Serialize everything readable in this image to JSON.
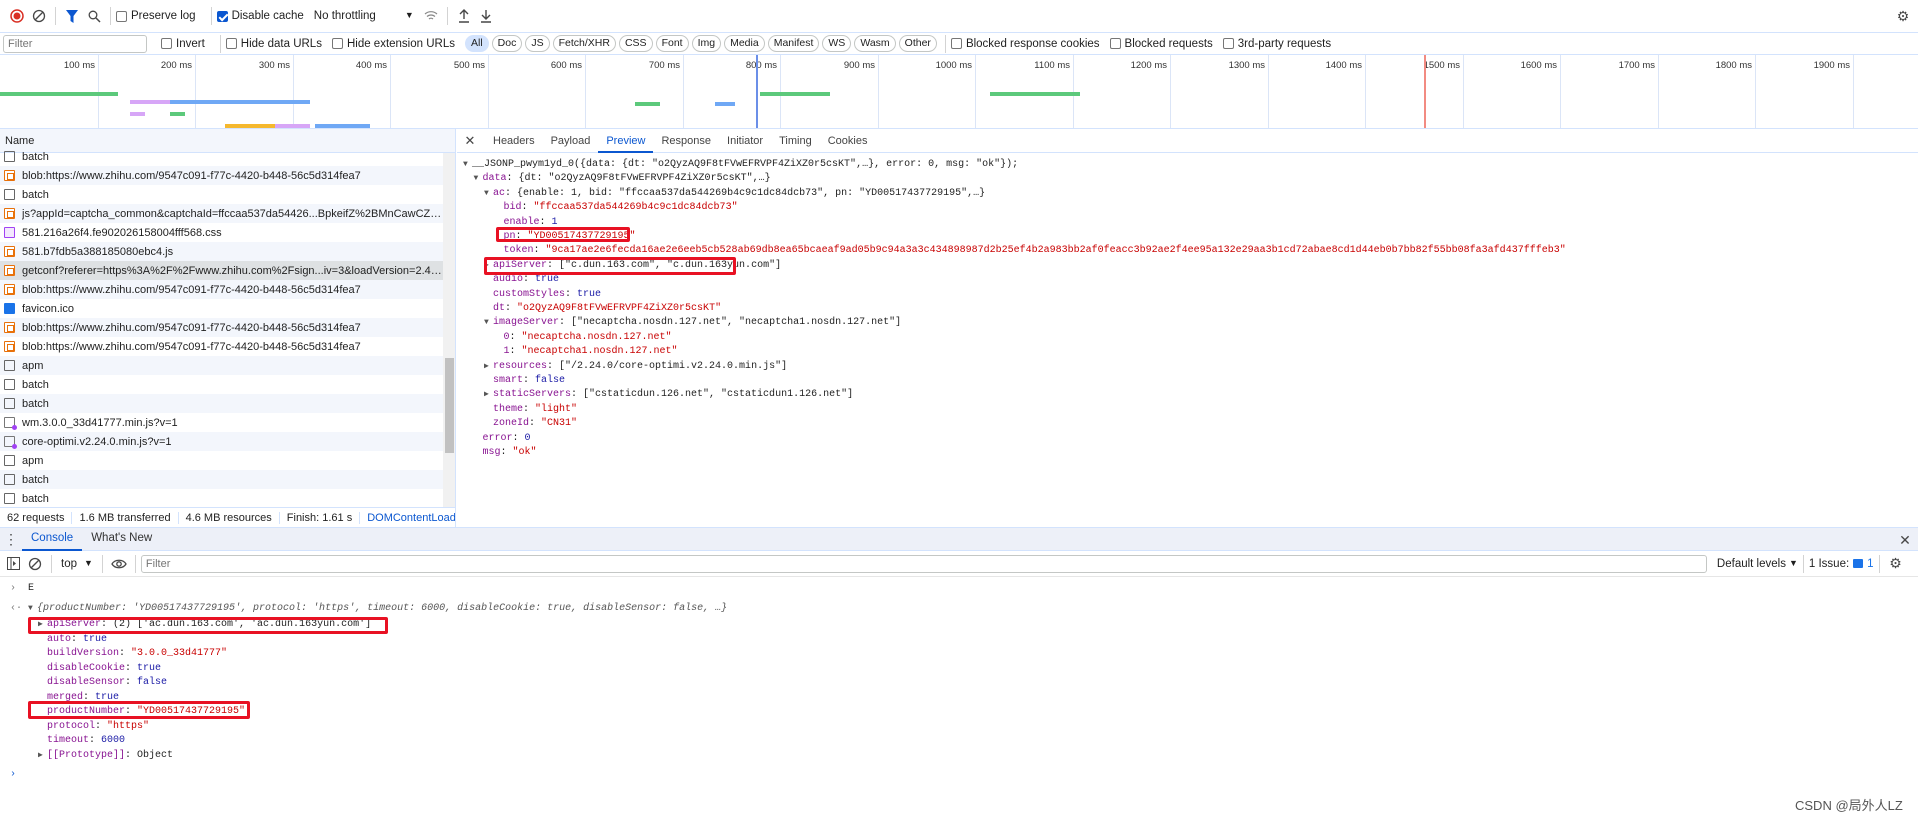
{
  "toolbar": {
    "preserve_log": "Preserve log",
    "preserve_log_checked": false,
    "disable_cache": "Disable cache",
    "disable_cache_checked": true,
    "throttling": "No throttling"
  },
  "filterbar": {
    "placeholder": "Filter",
    "invert": "Invert",
    "hide_data_urls": "Hide data URLs",
    "hide_extension_urls": "Hide extension URLs",
    "types": [
      "All",
      "Doc",
      "JS",
      "Fetch/XHR",
      "CSS",
      "Font",
      "Img",
      "Media",
      "Manifest",
      "WS",
      "Wasm",
      "Other"
    ],
    "selected_type": "All",
    "blocked_cookies": "Blocked response cookies",
    "blocked_requests": "Blocked requests",
    "third_party": "3rd-party requests"
  },
  "timeline": {
    "ticks": [
      "100 ms",
      "200 ms",
      "300 ms",
      "400 ms",
      "500 ms",
      "600 ms",
      "700 ms",
      "800 ms",
      "900 ms",
      "1000 ms",
      "1100 ms",
      "1200 ms",
      "1300 ms",
      "1400 ms",
      "1500 ms",
      "1600 ms",
      "1700 ms",
      "1800 ms",
      "1900 ms"
    ]
  },
  "requests": {
    "header": "Name",
    "items": [
      {
        "name": "batch",
        "type": "doc"
      },
      {
        "name": "blob:https://www.zhihu.com/9547c091-f77c-4420-b448-56c5d314fea7",
        "type": "script"
      },
      {
        "name": "batch",
        "type": "doc"
      },
      {
        "name": "js?appId=captcha_common&captchaId=ffccaa537da54426...BpkeifZ%2BMnCawCZOAZ...",
        "type": "script"
      },
      {
        "name": "581.216a26f4.fe902026158004fff568.css",
        "type": "css"
      },
      {
        "name": "581.b7fdb5a388185080ebc4.js",
        "type": "script"
      },
      {
        "name": "getconf?referer=https%3A%2F%2Fwww.zhihu.com%2Fsign...iv=3&loadVersion=2.4.0&...",
        "type": "script",
        "selected": true
      },
      {
        "name": "blob:https://www.zhihu.com/9547c091-f77c-4420-b448-56c5d314fea7",
        "type": "script"
      },
      {
        "name": "favicon.ico",
        "type": "img"
      },
      {
        "name": "blob:https://www.zhihu.com/9547c091-f77c-4420-b448-56c5d314fea7",
        "type": "script"
      },
      {
        "name": "blob:https://www.zhihu.com/9547c091-f77c-4420-b448-56c5d314fea7",
        "type": "script"
      },
      {
        "name": "apm",
        "type": "doc"
      },
      {
        "name": "batch",
        "type": "doc"
      },
      {
        "name": "batch",
        "type": "doc"
      },
      {
        "name": "wm.3.0.0_33d41777.min.js?v=1",
        "type": "wasm"
      },
      {
        "name": "core-optimi.v2.24.0.min.js?v=1",
        "type": "wasm"
      },
      {
        "name": "apm",
        "type": "doc"
      },
      {
        "name": "batch",
        "type": "doc"
      },
      {
        "name": "batch",
        "type": "doc"
      }
    ]
  },
  "summary": [
    "62 requests",
    "1.6 MB transferred",
    "4.6 MB resources",
    "Finish: 1.61 s",
    "DOMContentLoaded"
  ],
  "detail": {
    "tabs": [
      "Headers",
      "Payload",
      "Preview",
      "Response",
      "Initiator",
      "Timing",
      "Cookies"
    ],
    "selected_tab": "Preview",
    "preview": [
      {
        "i": 0,
        "a": "down",
        "k": "",
        "v": "__JSONP_pwym1yd_0({data: {dt: \"o2QyzAQ9F8tFVwEFRVPF4ZiXZ0r5csKT\",…}, error: 0, msg: \"ok\"});",
        "t": "p"
      },
      {
        "i": 1,
        "a": "down",
        "k": "data",
        "v": "{dt: \"o2QyzAQ9F8tFVwEFRVPF4ZiXZ0r5csKT\",…}",
        "t": "p"
      },
      {
        "i": 2,
        "a": "down",
        "k": "ac",
        "v": "{enable: 1, bid: \"ffccaa537da544269b4c9c1dc84dcb73\", pn: \"YD00517437729195\",…}",
        "t": "p"
      },
      {
        "i": 3,
        "a": "",
        "k": "bid",
        "v": "\"ffccaa537da544269b4c9c1dc84dcb73\"",
        "t": "s"
      },
      {
        "i": 3,
        "a": "",
        "k": "enable",
        "v": "1",
        "t": "n"
      },
      {
        "i": 3,
        "a": "",
        "k": "pn",
        "v": "\"YD00517437729195\"",
        "t": "s"
      },
      {
        "i": 3,
        "a": "",
        "k": "token",
        "v": "\"9ca17ae2e6fecda16ae2e6eeb5cb528ab69db8ea65bcaeaf9ad05b9c94a3a3c434898987d2b25ef4b2a983bb2af0feacc3b92ae2f4ee95a132e29aa3b1cd72abae8cd1d44eb0b7bb82f55bb08fa3afd437fffeb3\"",
        "t": "s"
      },
      {
        "i": 2,
        "a": "right",
        "k": "apiServer",
        "v": "[\"c.dun.163.com\", \"c.dun.163yun.com\"]",
        "t": "p"
      },
      {
        "i": 2,
        "a": "",
        "k": "audio",
        "v": "true",
        "t": "n"
      },
      {
        "i": 2,
        "a": "",
        "k": "customStyles",
        "v": "true",
        "t": "n"
      },
      {
        "i": 2,
        "a": "",
        "k": "dt",
        "v": "\"o2QyzAQ9F8tFVwEFRVPF4ZiXZ0r5csKT\"",
        "t": "s"
      },
      {
        "i": 2,
        "a": "down",
        "k": "imageServer",
        "v": "[\"necaptcha.nosdn.127.net\", \"necaptcha1.nosdn.127.net\"]",
        "t": "p"
      },
      {
        "i": 3,
        "a": "",
        "k": "0",
        "v": "\"necaptcha.nosdn.127.net\"",
        "t": "s"
      },
      {
        "i": 3,
        "a": "",
        "k": "1",
        "v": "\"necaptcha1.nosdn.127.net\"",
        "t": "s"
      },
      {
        "i": 2,
        "a": "right",
        "k": "resources",
        "v": "[\"/2.24.0/core-optimi.v2.24.0.min.js\"]",
        "t": "p"
      },
      {
        "i": 2,
        "a": "",
        "k": "smart",
        "v": "false",
        "t": "n"
      },
      {
        "i": 2,
        "a": "right",
        "k": "staticServers",
        "v": "[\"cstaticdun.126.net\", \"cstaticdun1.126.net\"]",
        "t": "p"
      },
      {
        "i": 2,
        "a": "",
        "k": "theme",
        "v": "\"light\"",
        "t": "s"
      },
      {
        "i": 2,
        "a": "",
        "k": "zoneId",
        "v": "\"CN31\"",
        "t": "s"
      },
      {
        "i": 1,
        "a": "",
        "k": "error",
        "v": "0",
        "t": "n"
      },
      {
        "i": 1,
        "a": "",
        "k": "msg",
        "v": "\"ok\"",
        "t": "s"
      }
    ]
  },
  "drawer": {
    "tabs": [
      "Console",
      "What's New"
    ],
    "selected_tab": "Console",
    "context": "top",
    "filter_placeholder": "Filter",
    "levels": "Default levels",
    "issues_label": "1 Issue:",
    "issues_count": "1"
  },
  "console": {
    "input": "E",
    "summary": "{productNumber: 'YD00517437729195', protocol: 'https', timeout: 6000, disableCookie: true, disableSensor: false, …}",
    "lines": [
      {
        "a": "right",
        "k": "apiServer",
        "v": "(2) ['ac.dun.163.com', 'ac.dun.163yun.com']",
        "t": "p"
      },
      {
        "a": "",
        "k": "auto",
        "v": "true",
        "t": "n"
      },
      {
        "a": "",
        "k": "buildVersion",
        "v": "\"3.0.0_33d41777\"",
        "t": "s"
      },
      {
        "a": "",
        "k": "disableCookie",
        "v": "true",
        "t": "n"
      },
      {
        "a": "",
        "k": "disableSensor",
        "v": "false",
        "t": "n"
      },
      {
        "a": "",
        "k": "merged",
        "v": "true",
        "t": "n"
      },
      {
        "a": "",
        "k": "productNumber",
        "v": "\"YD00517437729195\"",
        "t": "s"
      },
      {
        "a": "",
        "k": "protocol",
        "v": "\"https\"",
        "t": "s"
      },
      {
        "a": "",
        "k": "timeout",
        "v": "6000",
        "t": "n"
      },
      {
        "a": "right",
        "k": "[[Prototype]]",
        "v": "Object",
        "t": "p"
      }
    ]
  },
  "watermark": "CSDN @局外人LZ",
  "colors": {
    "accent": "#0b57d0",
    "highlight": "#e81123",
    "key": "#881391",
    "string": "#c80000",
    "number": "#1a1aa6"
  }
}
